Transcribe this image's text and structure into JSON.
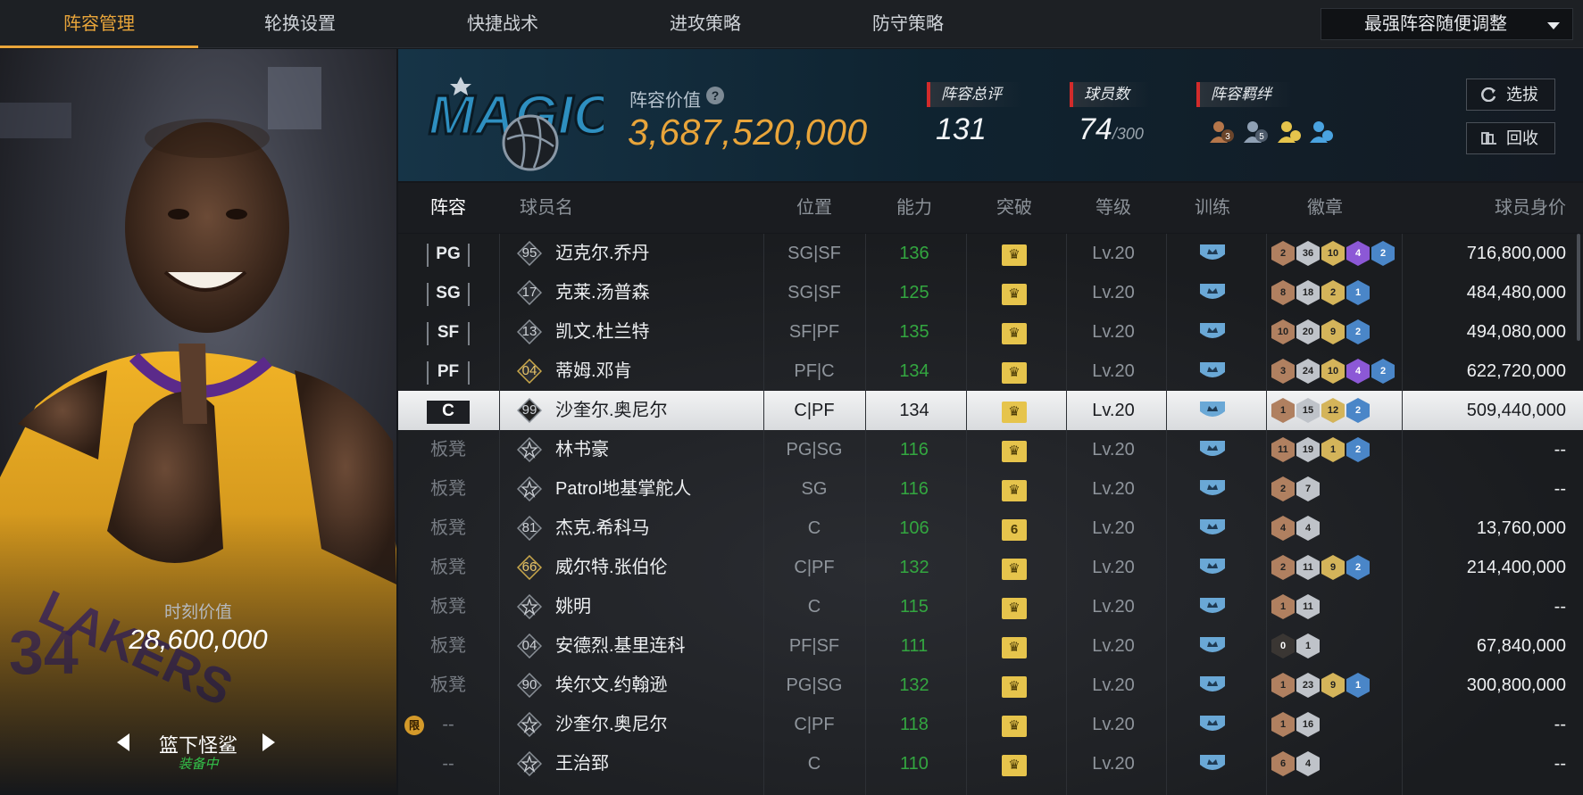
{
  "nav": {
    "tabs": [
      "阵容管理",
      "轮换设置",
      "快捷战术",
      "进攻策略",
      "防守策略"
    ],
    "active_tab": "阵容管理",
    "preset": "最强阵容随便调整"
  },
  "card": {
    "moment_label": "时刻价值",
    "moment_value": "28,600,000",
    "name": "篮下怪鲨",
    "status": "装备中"
  },
  "header": {
    "value_label": "阵容价值",
    "value_help": "?",
    "value": "3,687,520,000",
    "rating_label": "阵容总评",
    "rating": "131",
    "players_label": "球员数",
    "players_count": "74",
    "players_max": "/300",
    "bond_label": "阵容羁绊",
    "bond_icons": [
      {
        "icon": "bond-person-3-icon",
        "label": "3",
        "color": "#b5764a"
      },
      {
        "icon": "bond-person-5-icon",
        "label": "5",
        "color": "#8fa0b4"
      },
      {
        "icon": "bond-gold-icon",
        "label": "",
        "color": "#e6c44c"
      },
      {
        "icon": "bond-blue-icon",
        "label": "",
        "color": "#4aa3e0"
      }
    ],
    "pick_button": "选拔",
    "recycle_button": "回收"
  },
  "table": {
    "columns": [
      "阵容",
      "球员名",
      "位置",
      "能力",
      "突破",
      "等级",
      "训练",
      "徽章",
      "球员身价"
    ],
    "rows": [
      {
        "slot": "PG",
        "boxed": true,
        "num": "95",
        "name": "迈克尔.乔丹",
        "pos": "SG|SF",
        "ability": "136",
        "breakthrough": "crown",
        "level": "Lv.20",
        "badges": [
          [
            "2",
            "#b08060"
          ],
          [
            "36",
            "#bfc3c9"
          ],
          [
            "10",
            "#d4b45a"
          ],
          [
            "4",
            "#8c58d6"
          ],
          [
            "2",
            "#4a86c8"
          ]
        ],
        "worth": "716,800,000"
      },
      {
        "slot": "SG",
        "boxed": true,
        "num": "17",
        "name": "克莱.汤普森",
        "pos": "SG|SF",
        "ability": "125",
        "breakthrough": "crown",
        "level": "Lv.20",
        "badges": [
          [
            "8",
            "#b08060"
          ],
          [
            "18",
            "#bfc3c9"
          ],
          [
            "2",
            "#d4b45a"
          ],
          [
            "1",
            "#4a86c8"
          ]
        ],
        "worth": "484,480,000"
      },
      {
        "slot": "SF",
        "boxed": true,
        "num": "13",
        "name": "凯文.杜兰特",
        "pos": "SF|PF",
        "ability": "135",
        "breakthrough": "crown",
        "level": "Lv.20",
        "badges": [
          [
            "10",
            "#b08060"
          ],
          [
            "20",
            "#bfc3c9"
          ],
          [
            "9",
            "#d4b45a"
          ],
          [
            "2",
            "#4a86c8"
          ]
        ],
        "worth": "494,080,000"
      },
      {
        "slot": "PF",
        "boxed": true,
        "num": "04",
        "name": "蒂姆.邓肯",
        "pos": "PF|C",
        "ability": "134",
        "breakthrough": "crown",
        "level": "Lv.20",
        "badges": [
          [
            "3",
            "#b08060"
          ],
          [
            "24",
            "#bfc3c9"
          ],
          [
            "10",
            "#d4b45a"
          ],
          [
            "4",
            "#8c58d6"
          ],
          [
            "2",
            "#4a86c8"
          ]
        ],
        "worth": "622,720,000"
      },
      {
        "slot": "C",
        "boxed": true,
        "selected": true,
        "num": "99",
        "name": "沙奎尔.奥尼尔",
        "pos": "C|PF",
        "ability": "134",
        "breakthrough": "crown",
        "level": "Lv.20",
        "badges": [
          [
            "1",
            "#b08060"
          ],
          [
            "15",
            "#bfc3c9"
          ],
          [
            "12",
            "#d4b45a"
          ],
          [
            "2",
            "#4a86c8"
          ]
        ],
        "worth": "509,440,000"
      },
      {
        "slot": "板凳",
        "num": "",
        "name": "林书豪",
        "pos": "PG|SG",
        "ability": "116",
        "breakthrough": "crown",
        "level": "Lv.20",
        "badges": [
          [
            "11",
            "#b08060"
          ],
          [
            "19",
            "#bfc3c9"
          ],
          [
            "1",
            "#d4b45a"
          ],
          [
            "2",
            "#4a86c8"
          ]
        ],
        "worth": "--"
      },
      {
        "slot": "板凳",
        "num": "",
        "name": "Patrol地基掌舵人",
        "pos": "SG",
        "ability": "116",
        "breakthrough": "crown",
        "level": "Lv.20",
        "badges": [
          [
            "2",
            "#b08060"
          ],
          [
            "7",
            "#bfc3c9"
          ]
        ],
        "worth": "--"
      },
      {
        "slot": "板凳",
        "num": "81",
        "name": "杰克.希科马",
        "pos": "C",
        "ability": "106",
        "breakthrough": "6",
        "level": "Lv.20",
        "badges": [
          [
            "4",
            "#b08060"
          ],
          [
            "4",
            "#bfc3c9"
          ]
        ],
        "worth": "13,760,000"
      },
      {
        "slot": "板凳",
        "num": "66",
        "name": "威尔特.张伯伦",
        "pos": "C|PF",
        "ability": "132",
        "breakthrough": "crown",
        "level": "Lv.20",
        "badges": [
          [
            "2",
            "#b08060"
          ],
          [
            "11",
            "#bfc3c9"
          ],
          [
            "9",
            "#d4b45a"
          ],
          [
            "2",
            "#4a86c8"
          ]
        ],
        "worth": "214,400,000"
      },
      {
        "slot": "板凳",
        "num": "",
        "name": "姚明",
        "pos": "C",
        "ability": "115",
        "breakthrough": "crown",
        "level": "Lv.20",
        "badges": [
          [
            "1",
            "#b08060"
          ],
          [
            "11",
            "#bfc3c9"
          ]
        ],
        "worth": "--"
      },
      {
        "slot": "板凳",
        "num": "04",
        "name": "安德烈.基里连科",
        "pos": "PF|SF",
        "ability": "111",
        "breakthrough": "crown",
        "level": "Lv.20",
        "badges": [
          [
            "0",
            "#3a3633"
          ],
          [
            "1",
            "#bfc3c9"
          ]
        ],
        "worth": "67,840,000"
      },
      {
        "slot": "板凳",
        "num": "90",
        "name": "埃尔文.约翰逊",
        "pos": "PG|SG",
        "ability": "132",
        "breakthrough": "crown",
        "level": "Lv.20",
        "badges": [
          [
            "1",
            "#b08060"
          ],
          [
            "23",
            "#bfc3c9"
          ],
          [
            "9",
            "#d4b45a"
          ],
          [
            "1",
            "#4a86c8"
          ]
        ],
        "worth": "300,800,000"
      },
      {
        "slot": "--",
        "limited": "限",
        "num": "",
        "name": "沙奎尔.奥尼尔",
        "pos": "C|PF",
        "ability": "118",
        "breakthrough": "crown",
        "level": "Lv.20",
        "badges": [
          [
            "1",
            "#b08060"
          ],
          [
            "16",
            "#bfc3c9"
          ]
        ],
        "worth": "--"
      },
      {
        "slot": "--",
        "num": "",
        "name": "王治郅",
        "pos": "C",
        "ability": "110",
        "breakthrough": "crown",
        "level": "Lv.20",
        "badges": [
          [
            "6",
            "#b08060"
          ],
          [
            "4",
            "#bfc3c9"
          ]
        ],
        "worth": "--"
      }
    ]
  },
  "colors": {
    "accent": "#e9a53a",
    "ability_green": "#33a740",
    "equipped_green": "#33c24a",
    "tag_red": "#d22b2b"
  }
}
